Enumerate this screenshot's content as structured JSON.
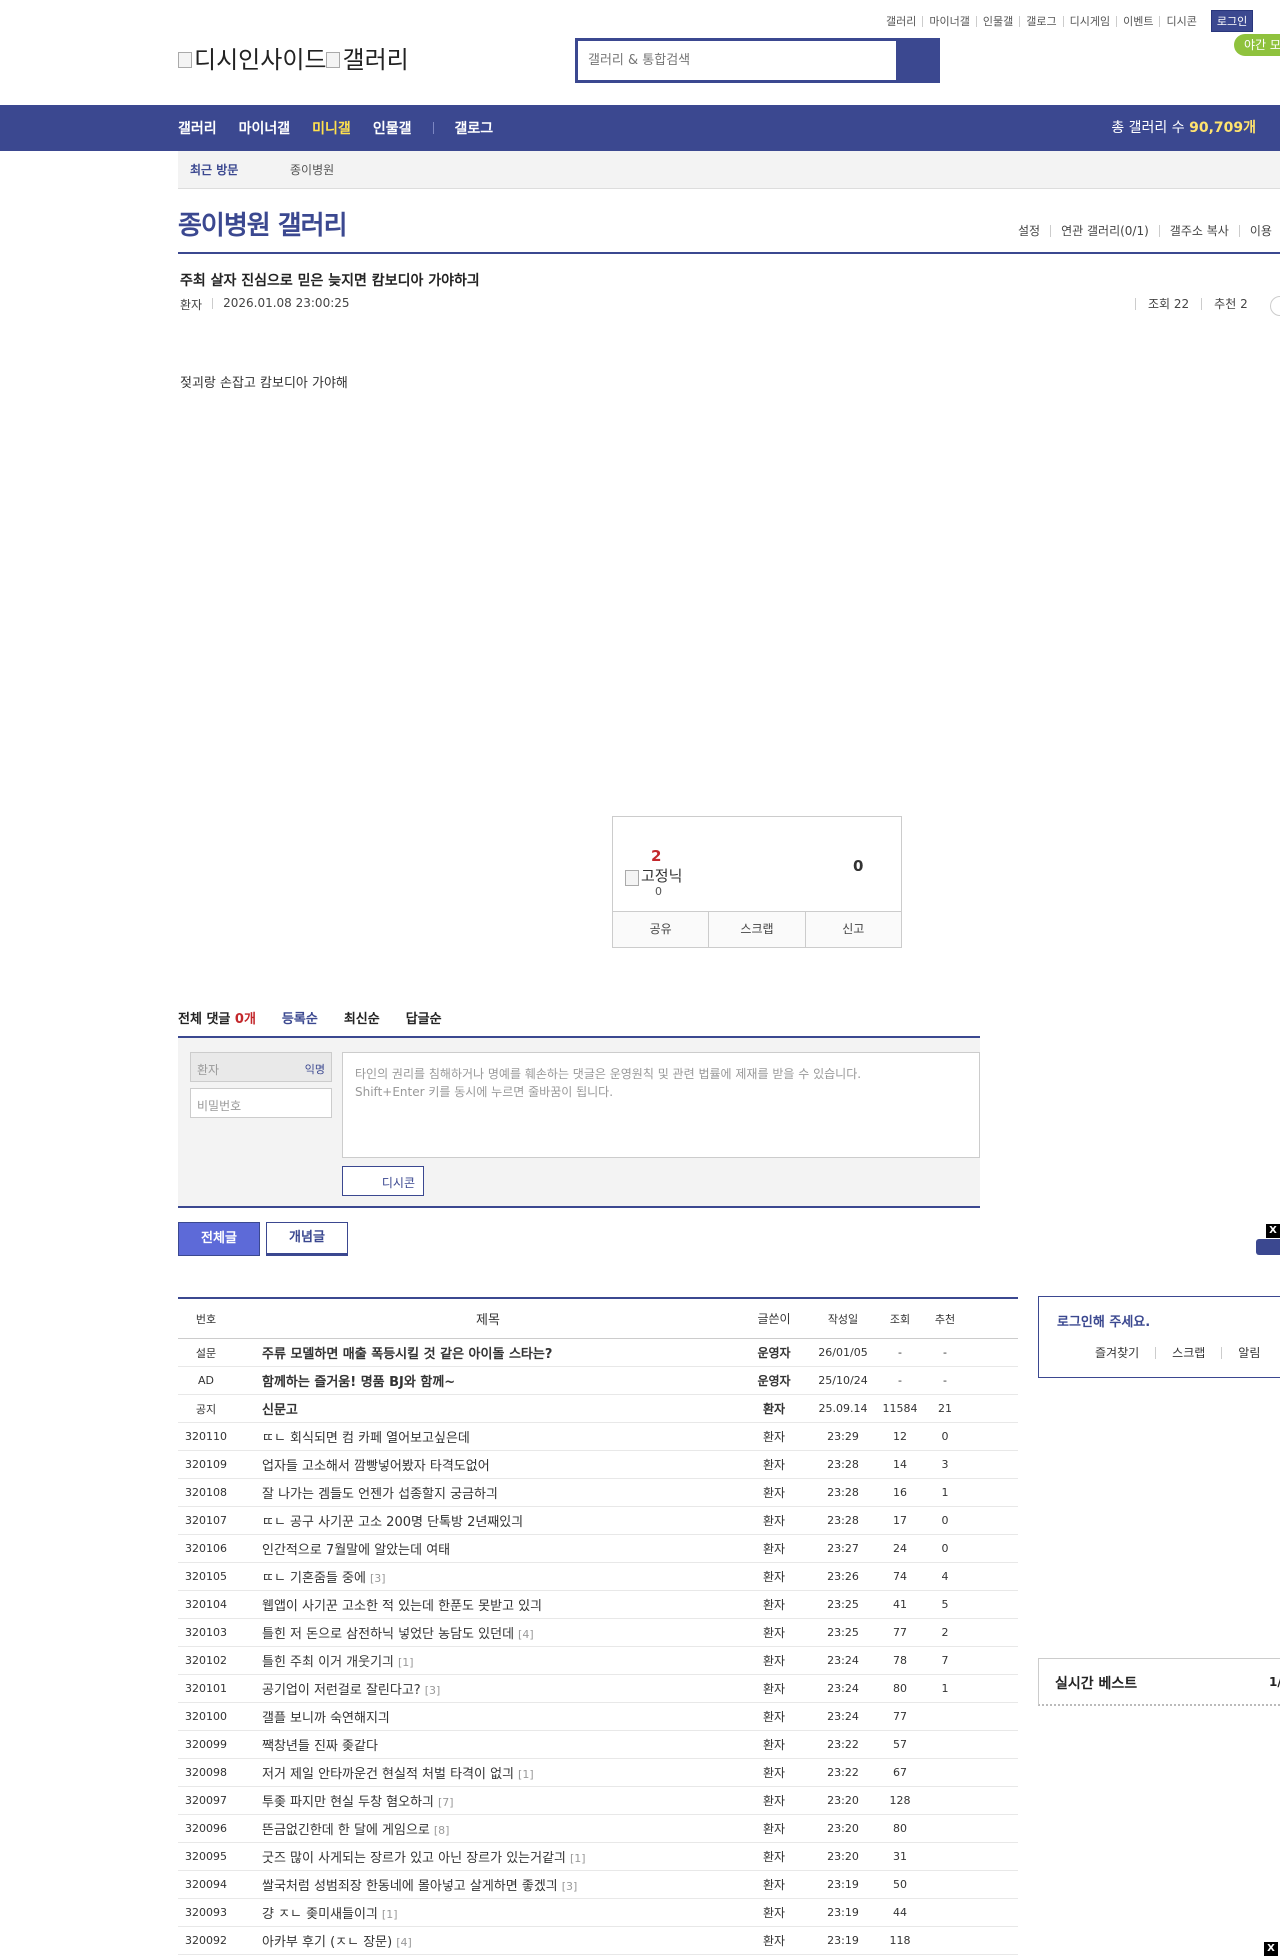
{
  "util_links": [
    "갤러리",
    "마이너갤",
    "인물갤",
    "갤로그",
    "디시게임",
    "이벤트",
    "디시콘"
  ],
  "login_label": "로그인",
  "night_mode_label": "야간 모",
  "logo": {
    "alt1": "디시인사이드",
    "alt2": "갤러리"
  },
  "search": {
    "placeholder": "갤러리 & 통합검색"
  },
  "nav": {
    "items": [
      "갤러리",
      "마이너갤",
      "미니갤",
      "인물갤",
      "갤로그"
    ],
    "active": "미니갤",
    "total_label": "총 갤러리 수",
    "total_value": "90,709개"
  },
  "recent": {
    "label": "최근 방문",
    "item": "종이병원"
  },
  "gallery": {
    "title": "종이병원 갤러리",
    "tools": [
      "설정",
      "연관 갤러리(0/1)",
      "갤주소 복사",
      "이용"
    ]
  },
  "post": {
    "title": "주최 살자 진심으로 믿은 늦지면 캄보디아 가야하긔",
    "writer": "환자",
    "datetime": "2026.01.08 23:00:25",
    "views_label": "조회 22",
    "recommend_label": "추천 2",
    "body": "젖괴랑 손잡고 캄보디아 가야해"
  },
  "recommend_box": {
    "up": "2",
    "fixed_label": "고정닉",
    "fixed_count": "0",
    "down": "0",
    "actions": [
      "공유",
      "스크랩",
      "신고"
    ]
  },
  "comments": {
    "total_label": "전체 댓글",
    "total_count": "0개",
    "sort": [
      "등록순",
      "최신순",
      "답글순"
    ],
    "name_placeholder": "환자",
    "anon_label": "익명",
    "pw_placeholder": "비밀번호",
    "text_placeholder_1": "타인의 권리를 침해하거나 명예를 훼손하는 댓글은 운영원칙 및 관련 법률에 제재를 받을 수 있습니다.",
    "text_placeholder_2": "Shift+Enter 키를 동시에 누르면 줄바꿈이 됩니다.",
    "dccon_label": "디시콘"
  },
  "list_tabs": [
    "전체글",
    "개념글"
  ],
  "list": {
    "headers": [
      "번호",
      "제목",
      "글쓴이",
      "작성일",
      "조회",
      "추천"
    ],
    "rows": [
      {
        "num": "설문",
        "title": "주류 모델하면 매출 폭등시킬 것 같은 아이돌 스타는?",
        "writer": "운영자",
        "date": "26/01/05",
        "views": "-",
        "rec": "-",
        "bold": true,
        "cmt": ""
      },
      {
        "num": "AD",
        "title": "함께하는 즐거움! 명품 BJ와 함께~",
        "writer": "운영자",
        "date": "25/10/24",
        "views": "-",
        "rec": "-",
        "bold": true,
        "cmt": ""
      },
      {
        "num": "공지",
        "title": "신문고",
        "writer": "환자",
        "date": "25.09.14",
        "views": "11584",
        "rec": "21",
        "bold": true,
        "cmt": ""
      },
      {
        "num": "320110",
        "title": "ㄸㄴ 회식되면 컴 카페 열어보고싶은데",
        "writer": "환자",
        "date": "23:29",
        "views": "12",
        "rec": "0",
        "bold": false,
        "cmt": ""
      },
      {
        "num": "320109",
        "title": "업자들 고소해서 깜빵넣어봤자 타격도없어",
        "writer": "환자",
        "date": "23:28",
        "views": "14",
        "rec": "3",
        "bold": false,
        "cmt": ""
      },
      {
        "num": "320108",
        "title": "잘 나가는 겜들도 언젠가 섭종할지 궁금하긔",
        "writer": "환자",
        "date": "23:28",
        "views": "16",
        "rec": "1",
        "bold": false,
        "cmt": ""
      },
      {
        "num": "320107",
        "title": "ㄸㄴ 공구 사기꾼 고소 200명 단톡방 2년째있긔",
        "writer": "환자",
        "date": "23:28",
        "views": "17",
        "rec": "0",
        "bold": false,
        "cmt": ""
      },
      {
        "num": "320106",
        "title": "인간적으로 7월말에 알았는데 여태",
        "writer": "환자",
        "date": "23:27",
        "views": "24",
        "rec": "0",
        "bold": false,
        "cmt": ""
      },
      {
        "num": "320105",
        "title": "ㄸㄴ 기혼줌들 중에",
        "writer": "환자",
        "date": "23:26",
        "views": "74",
        "rec": "4",
        "bold": false,
        "cmt": "[3]"
      },
      {
        "num": "320104",
        "title": "웹앱이 사기꾼 고소한 적 있는데 한푼도 못받고 있긔",
        "writer": "환자",
        "date": "23:25",
        "views": "41",
        "rec": "5",
        "bold": false,
        "cmt": ""
      },
      {
        "num": "320103",
        "title": "틀힌 저 돈으로 삼전하닉 넣었단 농담도 있던데",
        "writer": "환자",
        "date": "23:25",
        "views": "77",
        "rec": "2",
        "bold": false,
        "cmt": "[4]"
      },
      {
        "num": "320102",
        "title": "틀힌 주최 이거 개웃기긔",
        "writer": "환자",
        "date": "23:24",
        "views": "78",
        "rec": "7",
        "bold": false,
        "cmt": "[1]"
      },
      {
        "num": "320101",
        "title": "공기업이 저런걸로 잘린다고?",
        "writer": "환자",
        "date": "23:24",
        "views": "80",
        "rec": "1",
        "bold": false,
        "cmt": "[3]"
      },
      {
        "num": "320100",
        "title": "갤플 보니까 숙연해지긔",
        "writer": "환자",
        "date": "23:24",
        "views": "77",
        "rec": "",
        "bold": false,
        "cmt": ""
      },
      {
        "num": "320099",
        "title": "짹창년들 진짜 좆같다",
        "writer": "환자",
        "date": "23:22",
        "views": "57",
        "rec": "",
        "bold": false,
        "cmt": ""
      },
      {
        "num": "320098",
        "title": "저거 제일 안타까운건 현실적 처벌 타격이 없긔",
        "writer": "환자",
        "date": "23:22",
        "views": "67",
        "rec": "",
        "bold": false,
        "cmt": "[1]"
      },
      {
        "num": "320097",
        "title": "투좆 파지만 현실 두창 혐오하긔",
        "writer": "환자",
        "date": "23:20",
        "views": "128",
        "rec": "",
        "bold": false,
        "cmt": "[7]"
      },
      {
        "num": "320096",
        "title": "뜬금없긴한데 한 달에 게임으로",
        "writer": "환자",
        "date": "23:20",
        "views": "80",
        "rec": "",
        "bold": false,
        "cmt": "[8]"
      },
      {
        "num": "320095",
        "title": "굿즈 많이 사게되는 장르가 있고 아닌 장르가 있는거같긔",
        "writer": "환자",
        "date": "23:20",
        "views": "31",
        "rec": "",
        "bold": false,
        "cmt": "[1]"
      },
      {
        "num": "320094",
        "title": "쌀국처럼 성범죄장 한동네에 몰아넣고 살게하면 좋겠긔",
        "writer": "환자",
        "date": "23:19",
        "views": "50",
        "rec": "",
        "bold": false,
        "cmt": "[3]"
      },
      {
        "num": "320093",
        "title": "걍 ㅈㄴ 좆미새들이긔",
        "writer": "환자",
        "date": "23:19",
        "views": "44",
        "rec": "",
        "bold": false,
        "cmt": "[1]"
      },
      {
        "num": "320092",
        "title": "아카부 후기 (ㅈㄴ 장문)",
        "writer": "환자",
        "date": "23:19",
        "views": "118",
        "rec": "",
        "bold": false,
        "cmt": "[4]"
      }
    ]
  },
  "sidebar": {
    "login_msg": "로그인해 주세요.",
    "login_links": [
      "즐겨찾기",
      "스크랩",
      "알림"
    ],
    "best_title": "실시간 베스트",
    "best_page": "1/"
  },
  "close_glyph": "X",
  "colors": {
    "brand": "#3b4890",
    "highlight": "#ffe14d",
    "count_red": "#c3272b",
    "night_green": "#8fc23d"
  }
}
